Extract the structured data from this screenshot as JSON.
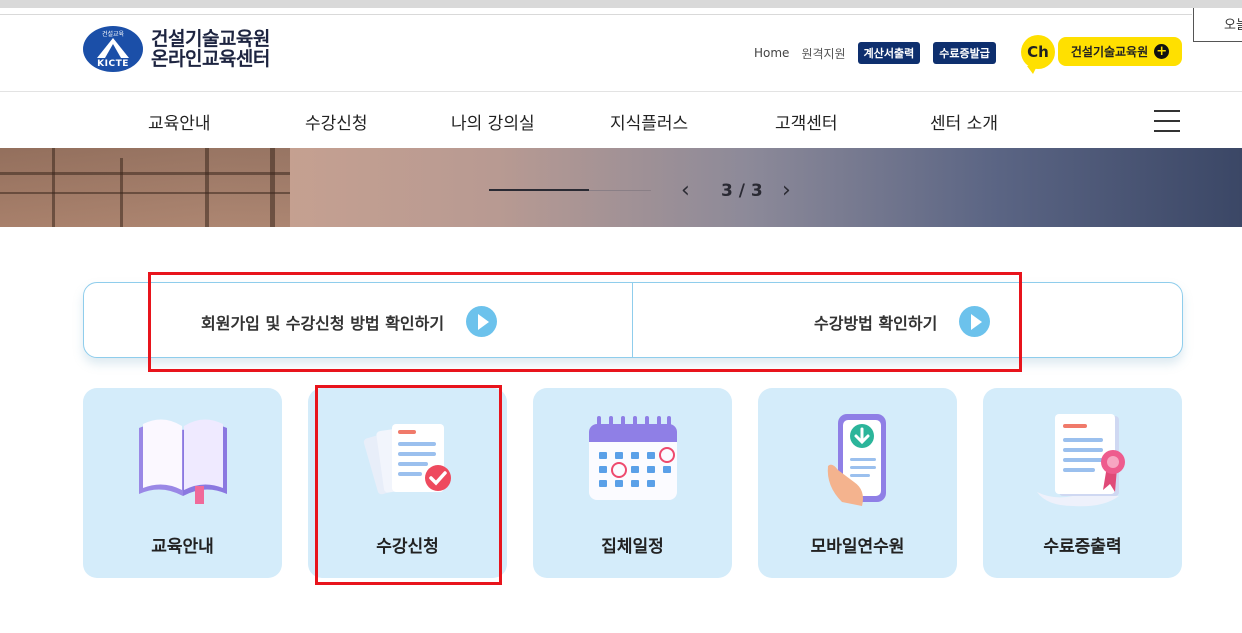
{
  "corner_popup": {
    "text": "오늘"
  },
  "logo": {
    "emblem_top": "건설교육",
    "emblem_text": "KICTE",
    "line1": "건설기술교육원",
    "line2": "온라인교육센터"
  },
  "util": {
    "home": "Home",
    "remote": "원격지원",
    "invoice": "계산서출력",
    "certificate": "수료증발급",
    "channel_icon": "Ch",
    "kakao": "건설기술교육원",
    "kakao_plus": "+"
  },
  "gnb": {
    "items": [
      "교육안내",
      "수강신청",
      "나의 강의실",
      "지식플러스",
      "고객센터",
      "센터 소개"
    ]
  },
  "banner": {
    "prev": "‹",
    "next": "›",
    "counter": "3 / 3",
    "progress": 0.62
  },
  "guide": {
    "signup": "회원가입 및 수강신청 방법 확인하기",
    "howto": "수강방법 확인하기"
  },
  "cards": [
    {
      "label": "교육안내",
      "icon": "open-book-icon"
    },
    {
      "label": "수강신청",
      "icon": "application-document-icon"
    },
    {
      "label": "집체일정",
      "icon": "calendar-icon"
    },
    {
      "label": "모바일연수원",
      "icon": "mobile-download-icon"
    },
    {
      "label": "수료증출력",
      "icon": "certificate-icon"
    }
  ],
  "colors": {
    "brand_navy": "#0e2f6e",
    "kakao_yellow": "#ffe000",
    "card_bg": "#d4ecfa",
    "guide_border": "#8fcdec",
    "play_blue": "#6cc2ec",
    "highlight_red": "#e8141c"
  }
}
